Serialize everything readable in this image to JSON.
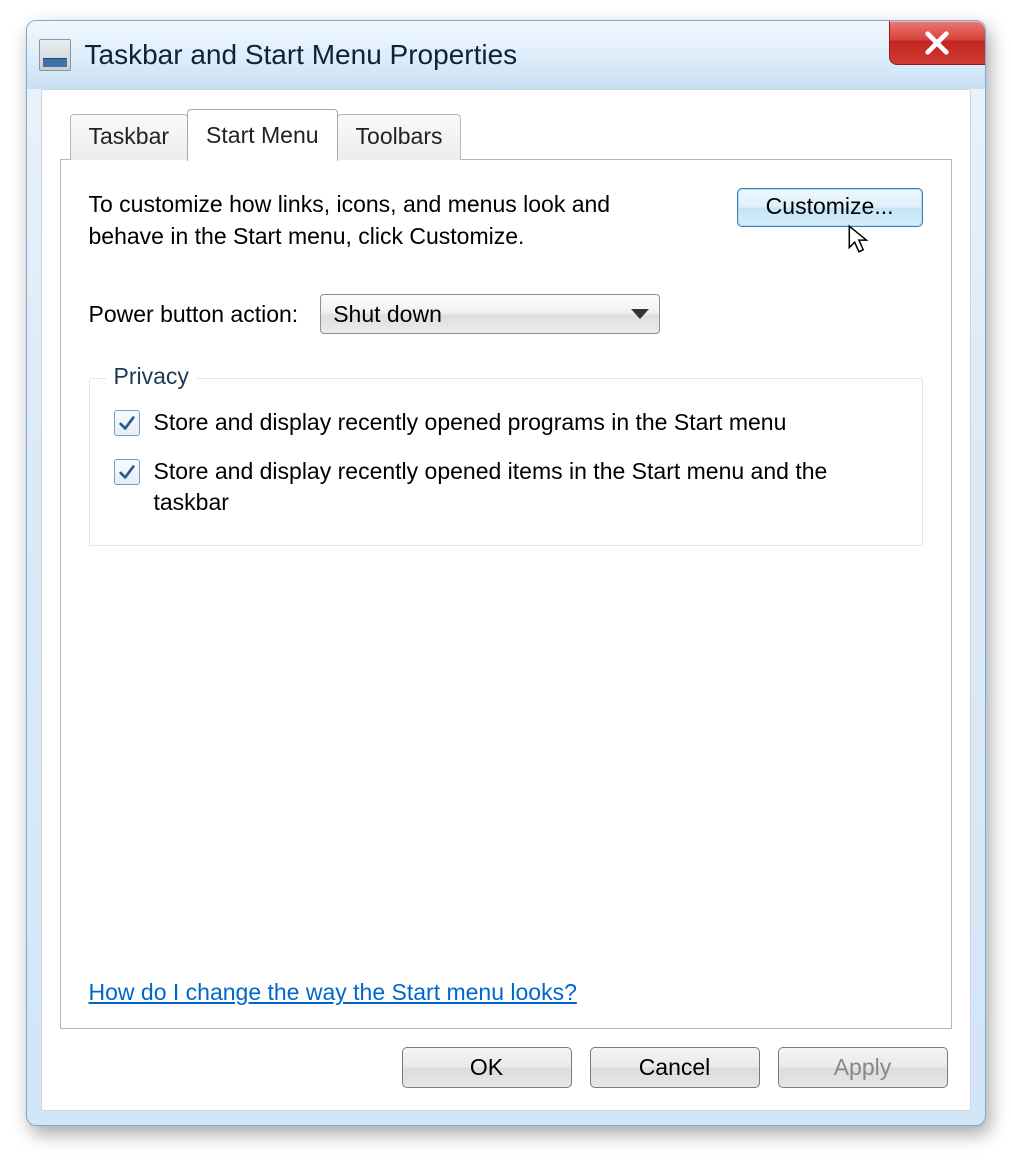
{
  "window": {
    "title": "Taskbar and Start Menu Properties"
  },
  "tabs": {
    "taskbar": "Taskbar",
    "startmenu": "Start Menu",
    "toolbars": "Toolbars"
  },
  "body": {
    "desc": "To customize how links, icons, and menus look and behave in the Start menu, click Customize.",
    "customize_label": "Customize...",
    "power_label": "Power button action:",
    "power_value": "Shut down",
    "privacy_legend": "Privacy",
    "privacy_opt1": "Store and display recently opened programs in the Start menu",
    "privacy_opt2": "Store and display recently opened items in the Start menu and the taskbar",
    "help_link": "How do I change the way the Start menu looks?"
  },
  "buttons": {
    "ok": "OK",
    "cancel": "Cancel",
    "apply": "Apply"
  }
}
